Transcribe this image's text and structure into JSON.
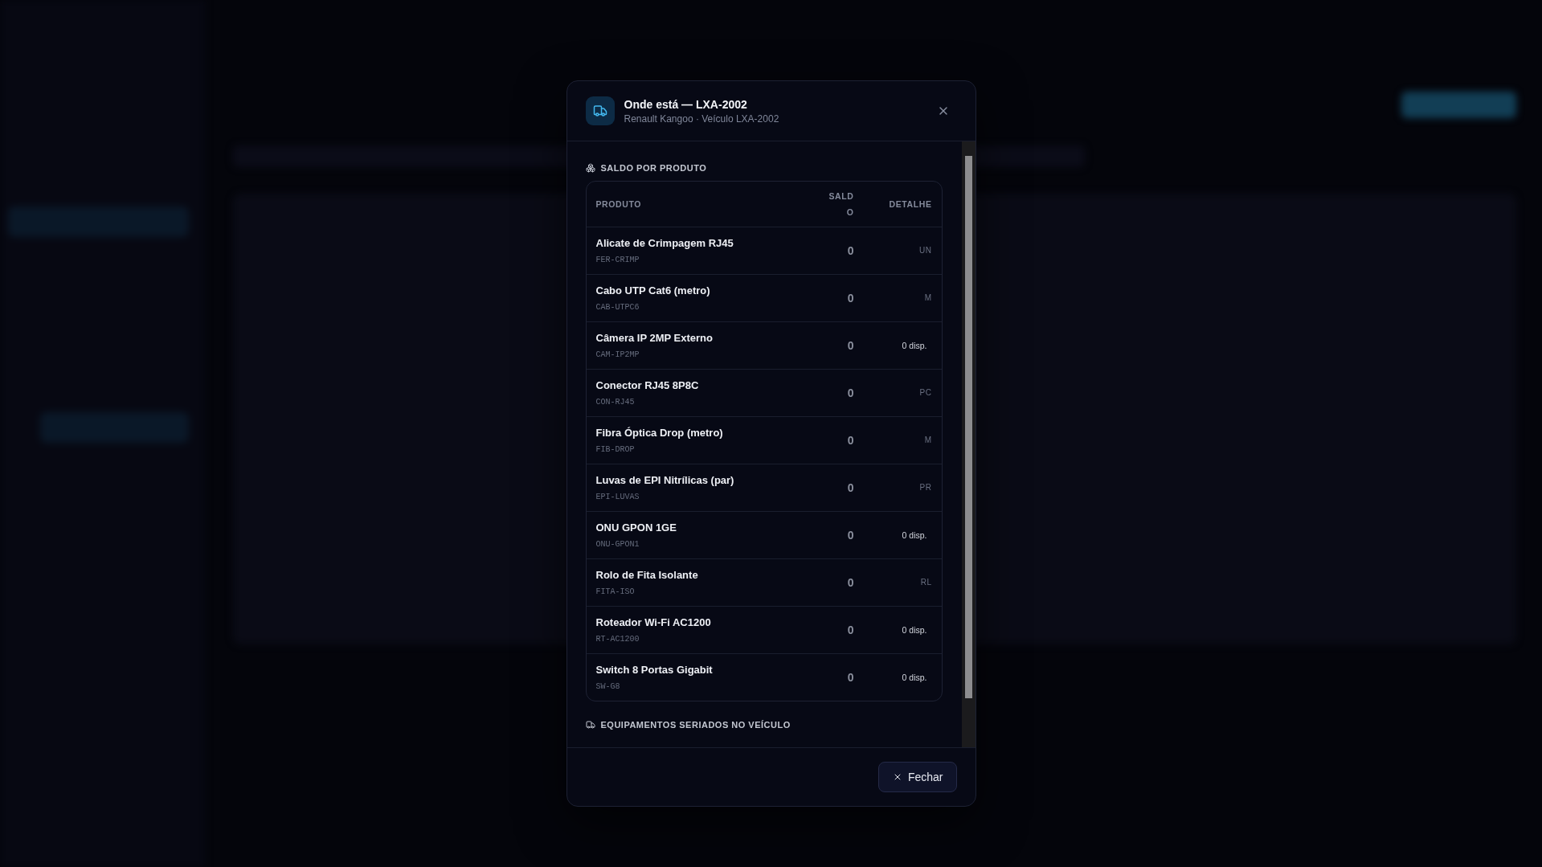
{
  "dialog": {
    "title": "Onde está — LXA-2002",
    "subtitle": "Renault Kangoo · Veículo LXA-2002",
    "sections": [
      {
        "kind": "table",
        "heading": "SALDO POR PRODUTO",
        "columns": [
          "PRODUTO",
          "SALDO",
          "DETALHE"
        ],
        "rows": [
          {
            "name": "Alicate de Crimpagem RJ45",
            "code": "FER-CRIMP",
            "balance": "0",
            "detail": "UN",
            "kind": "unit"
          },
          {
            "name": "Cabo UTP Cat6 (metro)",
            "code": "CAB-UTPC6",
            "balance": "0",
            "detail": "M",
            "kind": "unit"
          },
          {
            "name": "Câmera IP 2MP Externo",
            "code": "CAM-IP2MP",
            "balance": "0",
            "detail": "0 disp.",
            "kind": "stock"
          },
          {
            "name": "Conector RJ45 8P8C",
            "code": "CON-RJ45",
            "balance": "0",
            "detail": "PC",
            "kind": "unit"
          },
          {
            "name": "Fibra Óptica Drop (metro)",
            "code": "FIB-DROP",
            "balance": "0",
            "detail": "M",
            "kind": "unit"
          },
          {
            "name": "Luvas de EPI Nitrílicas (par)",
            "code": "EPI-LUVAS",
            "balance": "0",
            "detail": "PR",
            "kind": "unit"
          },
          {
            "name": "ONU GPON 1GE",
            "code": "ONU-GPON1",
            "balance": "0",
            "detail": "0 disp.",
            "kind": "stock"
          },
          {
            "name": "Rolo de Fita Isolante",
            "code": "FITA-ISO",
            "balance": "0",
            "detail": "RL",
            "kind": "unit"
          },
          {
            "name": "Roteador Wi-Fi AC1200",
            "code": "RT-AC1200",
            "balance": "0",
            "detail": "0 disp.",
            "kind": "stock"
          },
          {
            "name": "Switch 8 Portas Gigabit",
            "code": "SW-G8",
            "balance": "0",
            "detail": "0 disp.",
            "kind": "stock"
          }
        ]
      },
      {
        "kind": "list",
        "heading": "EQUIPAMENTOS SERIADOS NO VEÍCULO"
      }
    ],
    "close_button": "Fechar"
  }
}
